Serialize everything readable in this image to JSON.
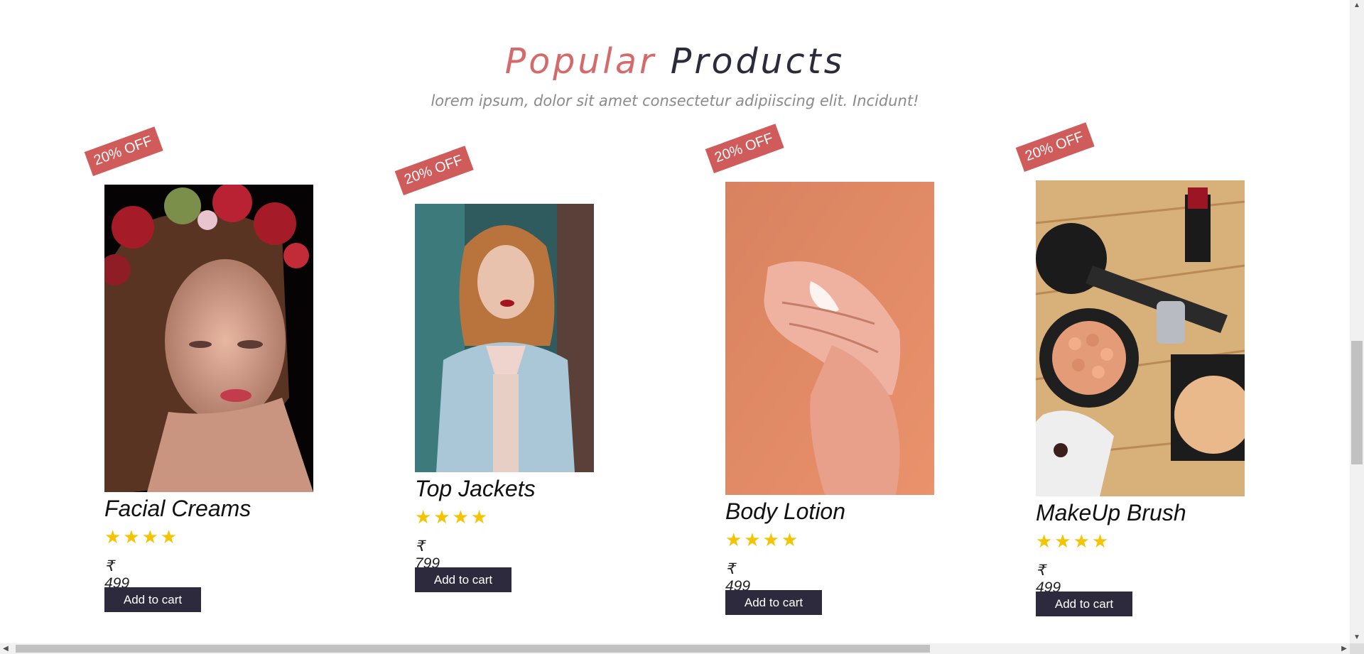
{
  "section": {
    "title_accent": "Popular",
    "title_rest": "Products",
    "subtitle": "lorem ipsum, dolor sit amet consectetur adipiiscing elit. Incidunt!"
  },
  "products": [
    {
      "badge": "20% OFF",
      "name": "Facial Creams",
      "rating_stars": "★★★★",
      "rating": 4,
      "price": "₹ 499",
      "cart_label": "Add to cart",
      "image": "woman-with-flower-crown-photo"
    },
    {
      "badge": "20% OFF",
      "name": "Top Jackets",
      "rating_stars": "★★★★",
      "rating": 4,
      "price": "₹ 799",
      "cart_label": "Add to cart",
      "image": "woman-in-denim-jacket-photo"
    },
    {
      "badge": "20% OFF",
      "name": "Body Lotion",
      "rating_stars": "★★★★",
      "rating": 4,
      "price": "₹ 499",
      "cart_label": "Add to cart",
      "image": "hands-applying-lotion-photo"
    },
    {
      "badge": "20% OFF",
      "name": "MakeUp Brush",
      "rating_stars": "★★★★",
      "rating": 4,
      "price": "₹ 499",
      "cart_label": "Add to cart",
      "image": "makeup-products-photo"
    }
  ],
  "colors": {
    "accent": "#d46a6a",
    "dark": "#2c2b3b",
    "badge": "#d05b5b",
    "star": "#f5c400",
    "button": "#2d2a3e"
  }
}
